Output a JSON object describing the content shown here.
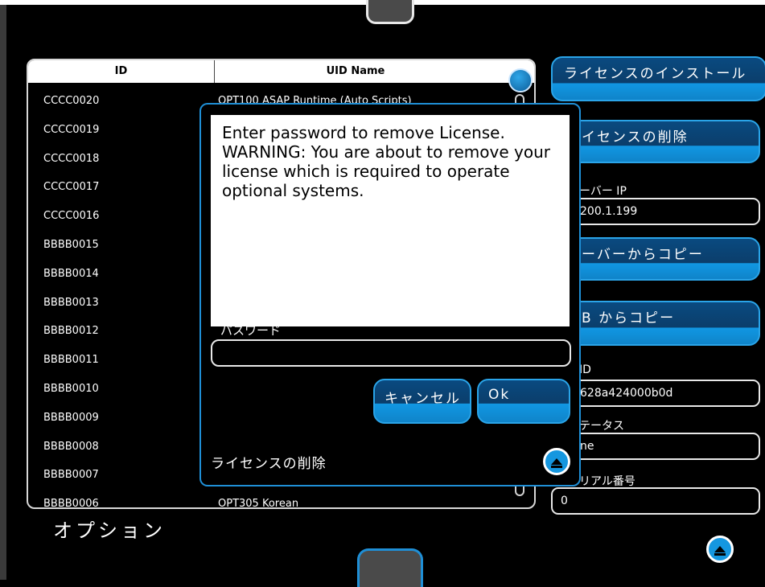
{
  "table": {
    "headers": {
      "id": "ID",
      "uid": "UID Name"
    },
    "rows": [
      {
        "id": "CCCC0020",
        "uid": "OPT100 ASAP Runtime (Auto Scripts)"
      },
      {
        "id": "CCCC0019",
        "uid": ""
      },
      {
        "id": "CCCC0018",
        "uid": ""
      },
      {
        "id": "CCCC0017",
        "uid": ""
      },
      {
        "id": "CCCC0016",
        "uid": ""
      },
      {
        "id": "BBBB0015",
        "uid": ""
      },
      {
        "id": "BBBB0014",
        "uid": ""
      },
      {
        "id": "BBBB0013",
        "uid": ""
      },
      {
        "id": "BBBB0012",
        "uid": ""
      },
      {
        "id": "BBBB0011",
        "uid": ""
      },
      {
        "id": "BBBB0010",
        "uid": ""
      },
      {
        "id": "BBBB0009",
        "uid": ""
      },
      {
        "id": "BBBB0008",
        "uid": ""
      },
      {
        "id": "BBBB0007",
        "uid": ""
      },
      {
        "id": "BBBB0006",
        "uid": "OPT305 Korean"
      }
    ]
  },
  "side": {
    "install_label": "ライセンスのインストール",
    "remove_label": "イセンスの削除",
    "server_ip_label": "ーバー IP",
    "server_ip_value": "200.1.199",
    "copy_server_label": "ーバーからコピー",
    "copy_usb_label": "B からコピー",
    "host_id_label": "ID",
    "host_id_value": "628a424000b0d",
    "status_label": "テータス",
    "status_value": "ne",
    "serial_label": "リアル番号",
    "serial_value": "0"
  },
  "bottom": {
    "options_label": "オプション"
  },
  "dialog": {
    "message": "Enter password to remove License.\nWARNING: You are about to remove your license which is required to operate optional systems.",
    "password_label": "パスワード",
    "password_value": "",
    "cancel_label": "キャンセル",
    "ok_label": "Ok",
    "title": "ライセンスの削除"
  },
  "colors": {
    "accent": "#1f8fd6",
    "button_dark": "#0a4a80",
    "button_light": "#1197e3"
  }
}
